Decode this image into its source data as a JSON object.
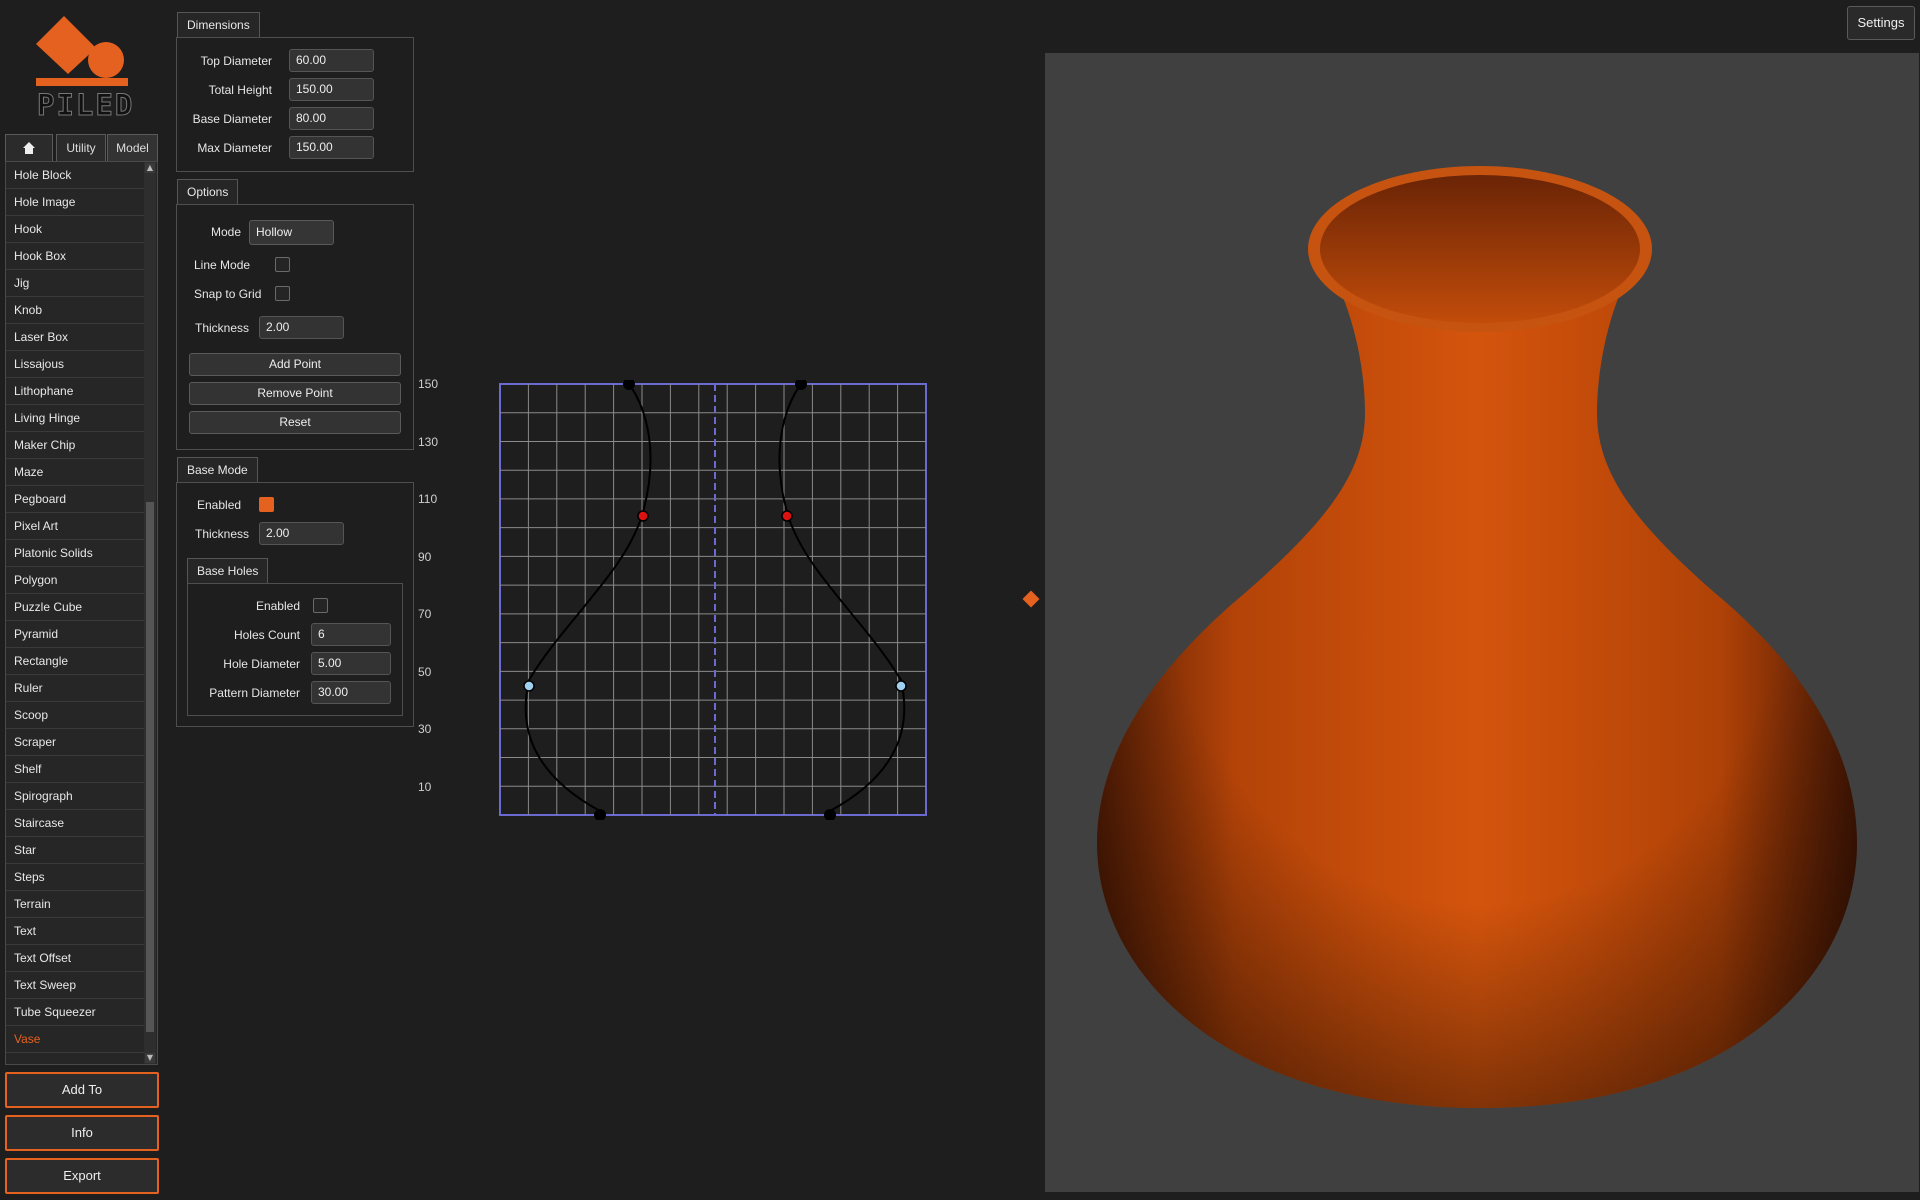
{
  "app": {
    "logo_text": "PILED",
    "accent": "#e4611f"
  },
  "tabs": [
    {
      "label": "",
      "icon": "home-icon"
    },
    {
      "label": "Utility"
    },
    {
      "label": "Model"
    }
  ],
  "models": [
    "Hole Block",
    "Hole Image",
    "Hook",
    "Hook Box",
    "Jig",
    "Knob",
    "Laser Box",
    "Lissajous",
    "Lithophane",
    "Living Hinge",
    "Maker Chip",
    "Maze",
    "Pegboard",
    "Pixel Art",
    "Platonic Solids",
    "Polygon",
    "Puzzle Cube",
    "Pyramid",
    "Rectangle",
    "Ruler",
    "Scoop",
    "Scraper",
    "Shelf",
    "Spirograph",
    "Staircase",
    "Star",
    "Steps",
    "Terrain",
    "Text",
    "Text Offset",
    "Text Sweep",
    "Tube Squeezer",
    "Vase"
  ],
  "selected_model": "Vase",
  "side_buttons": {
    "add_to": "Add To",
    "info": "Info",
    "export": "Export"
  },
  "settings_label": "Settings",
  "dimensions": {
    "title": "Dimensions",
    "top_diameter": {
      "label": "Top Diameter",
      "value": "60.00"
    },
    "total_height": {
      "label": "Total Height",
      "value": "150.00"
    },
    "base_diameter": {
      "label": "Base Diameter",
      "value": "80.00"
    },
    "max_diameter": {
      "label": "Max Diameter",
      "value": "150.00"
    }
  },
  "options": {
    "title": "Options",
    "mode": {
      "label": "Mode",
      "value": "Hollow"
    },
    "line_mode": {
      "label": "Line Mode",
      "checked": false
    },
    "snap_to_grid": {
      "label": "Snap to Grid",
      "checked": false
    },
    "thickness": {
      "label": "Thickness",
      "value": "2.00"
    },
    "add_point": "Add Point",
    "remove_point": "Remove Point",
    "reset": "Reset"
  },
  "base_mode": {
    "title": "Base Mode",
    "enabled": {
      "label": "Enabled",
      "checked": true
    },
    "thickness": {
      "label": "Thickness",
      "value": "2.00"
    }
  },
  "base_holes": {
    "title": "Base Holes",
    "enabled": {
      "label": "Enabled",
      "checked": false
    },
    "holes_count": {
      "label": "Holes Count",
      "value": "6"
    },
    "hole_diameter": {
      "label": "Hole Diameter",
      "value": "5.00"
    },
    "pattern_diameter": {
      "label": "Pattern Diameter",
      "value": "30.00"
    }
  },
  "profile": {
    "y_ticks": [
      "150",
      "130",
      "110",
      "90",
      "70",
      "50",
      "30",
      "10"
    ]
  }
}
